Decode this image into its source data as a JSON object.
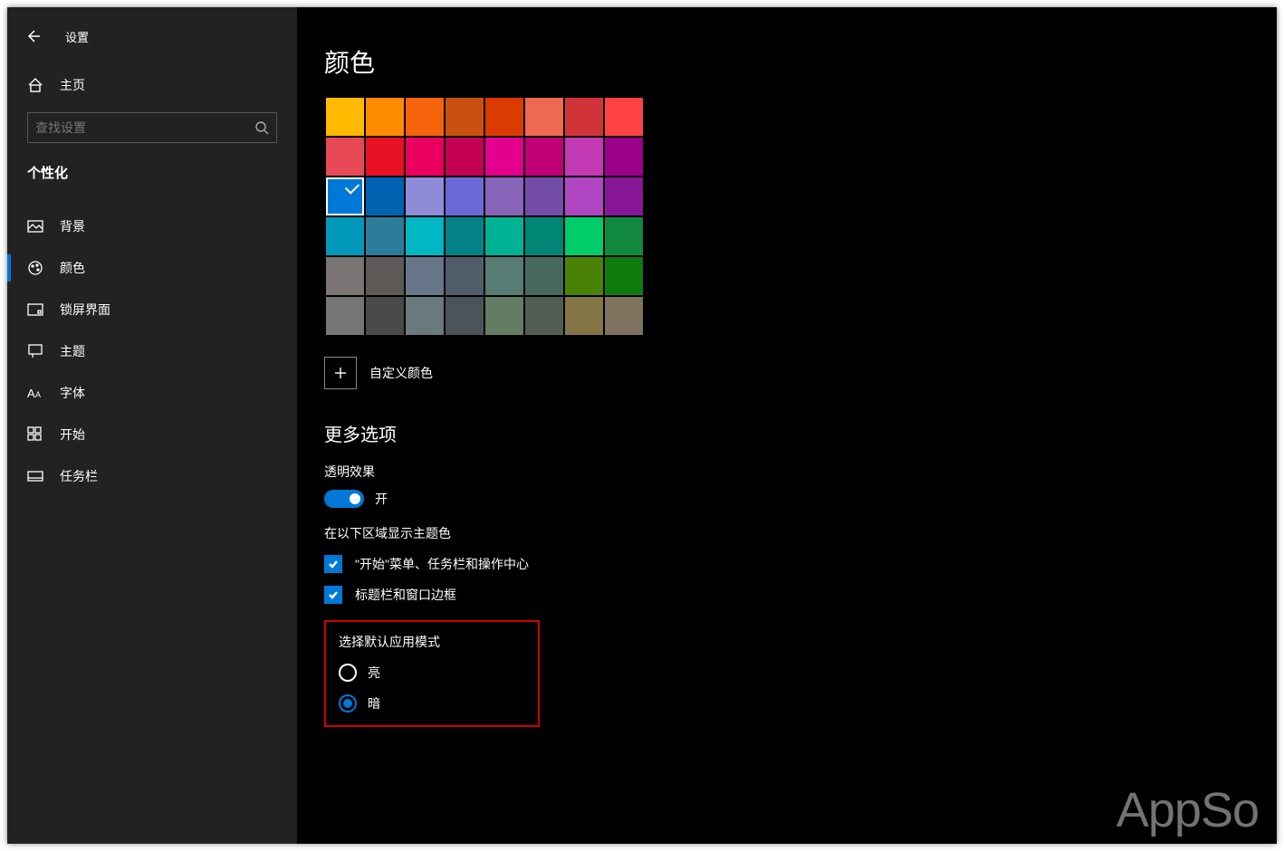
{
  "titlebar": {
    "app_name": "设置"
  },
  "home": {
    "label": "主页"
  },
  "search": {
    "placeholder": "查找设置"
  },
  "section": {
    "title": "个性化"
  },
  "nav": [
    {
      "label": "背景",
      "icon": "image-icon",
      "active": false
    },
    {
      "label": "颜色",
      "icon": "palette-icon",
      "active": true
    },
    {
      "label": "锁屏界面",
      "icon": "lock-rect-icon",
      "active": false
    },
    {
      "label": "主题",
      "icon": "brush-icon",
      "active": false
    },
    {
      "label": "字体",
      "icon": "font-icon",
      "active": false
    },
    {
      "label": "开始",
      "icon": "start-icon",
      "active": false
    },
    {
      "label": "任务栏",
      "icon": "taskbar-icon",
      "active": false
    }
  ],
  "page": {
    "title": "颜色",
    "custom_color": "自定义颜色",
    "more_options": "更多选项",
    "transparent": {
      "label": "透明效果",
      "state": "开",
      "on": true
    },
    "accent_surfaces_label": "在以下区域显示主题色",
    "checkboxes": [
      {
        "label": "\"开始\"菜单、任务栏和操作中心",
        "checked": true
      },
      {
        "label": "标题栏和窗口边框",
        "checked": true
      }
    ],
    "app_mode": {
      "title": "选择默认应用模式",
      "options": [
        {
          "value": "light",
          "label": "亮",
          "selected": false
        },
        {
          "value": "dark",
          "label": "暗",
          "selected": true
        }
      ]
    }
  },
  "colors": [
    [
      "#ffb900",
      "#ff8c00",
      "#f7630c",
      "#ca5010",
      "#da3b01",
      "#ef6950",
      "#d13438",
      "#ff4343"
    ],
    [
      "#e74856",
      "#e81123",
      "#ea005e",
      "#c30052",
      "#e3008c",
      "#bf0077",
      "#c239b3",
      "#9a0089"
    ],
    [
      "#0078d7",
      "#0063b1",
      "#8e8cd8",
      "#6b69d6",
      "#8764b8",
      "#744da9",
      "#b146c2",
      "#881798"
    ],
    [
      "#0099bc",
      "#2d7d9a",
      "#00b7c3",
      "#038387",
      "#00b294",
      "#018574",
      "#00cc6a",
      "#10893e"
    ],
    [
      "#7a7574",
      "#5d5a58",
      "#68768a",
      "#515c6b",
      "#567c73",
      "#486860",
      "#498205",
      "#107c10"
    ],
    [
      "#767676",
      "#4c4a48",
      "#69797e",
      "#4a5459",
      "#647c64",
      "#525e54",
      "#847545",
      "#7e735f"
    ]
  ],
  "selected_color": "#0078d7",
  "watermark": "AppSo"
}
